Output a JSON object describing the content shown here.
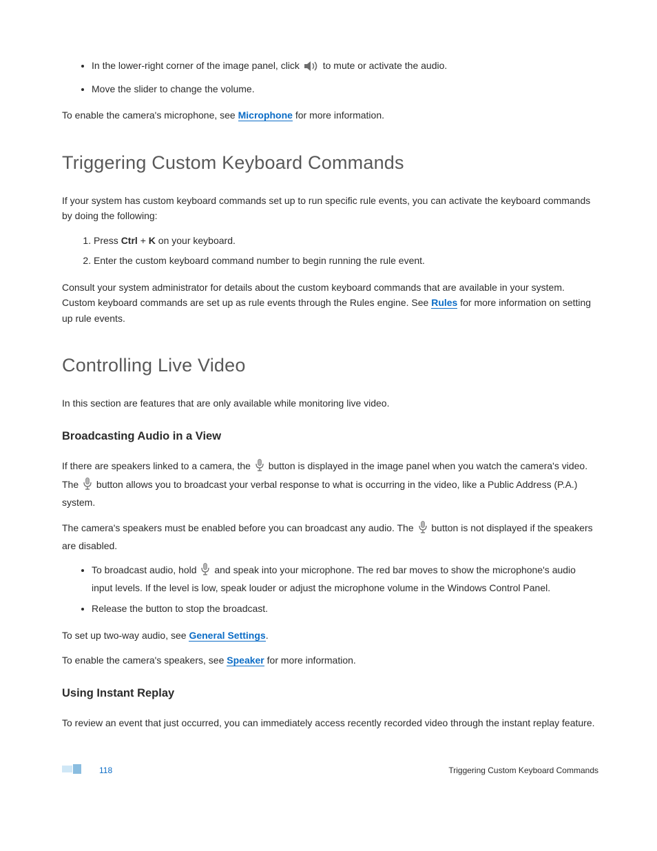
{
  "bullets_top": {
    "b1_a": "In the lower-right corner of the image panel, click",
    "b1_b": "to mute or activate the audio.",
    "b2": "Move the slider to change the volume."
  },
  "para_mic_a": "To enable the camera's microphone, see ",
  "link_mic": "Microphone",
  "para_mic_b": " for more information.",
  "h2_trigger": "Triggering Custom Keyboard Commands",
  "para_trigger_intro": "If your system has custom keyboard commands set up to run specific rule events, you can activate the keyboard commands by doing the following:",
  "ol_trigger": {
    "s1_a": "Press ",
    "s1_ctrl": "Ctrl",
    "s1_plus": " + ",
    "s1_k": "K",
    "s1_b": " on your keyboard.",
    "s2": "Enter the custom keyboard command number to begin running the rule event."
  },
  "para_trigger_note_a": "Consult your system administrator for details about the custom keyboard commands that are available in your system. Custom keyboard commands are set up as rule events through the Rules engine. See ",
  "link_rules": "Rules",
  "para_trigger_note_b": " for more information on setting up rule events.",
  "h2_live": "Controlling Live Video",
  "para_live_intro": "In this section are features that are only available while monitoring live video.",
  "h3_broadcast": "Broadcasting Audio in a View",
  "para_broadcast_1a": "If there are speakers linked to a camera, the ",
  "para_broadcast_1b": " button is displayed in the image panel when you watch the camera's video. The ",
  "para_broadcast_1c": " button allows you to broadcast your verbal response to what is occurring in the video, like a Public Address (P.A.) system.",
  "para_broadcast_2a": "The camera's speakers must be enabled before you can broadcast any audio. The ",
  "para_broadcast_2b": " button is not displayed if the speakers are disabled.",
  "bullets_broadcast": {
    "b1_a": "To broadcast audio, hold ",
    "b1_b": " and speak into your microphone. The red bar moves to show the microphone's audio input levels. If the level is low, speak louder or adjust the microphone volume in the Windows Control Panel.",
    "b2": "Release the button to stop the broadcast."
  },
  "para_twoway_a": "To set up two-way audio, see ",
  "link_general": "General Settings",
  "para_twoway_b": ".",
  "para_spk_a": "To enable the camera's speakers, see ",
  "link_speaker": "Speaker",
  "para_spk_b": " for more information.",
  "h3_replay": "Using Instant Replay",
  "para_replay": "To review an event that just occurred, you can immediately access recently recorded video through the instant replay feature.",
  "footer": {
    "page": "118",
    "crumb": "Triggering Custom Keyboard Commands"
  }
}
